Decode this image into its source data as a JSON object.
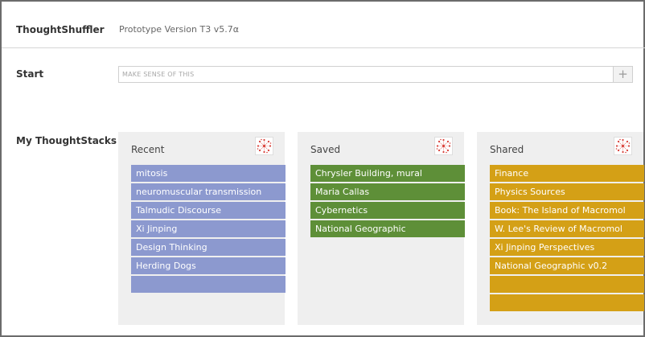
{
  "header": {
    "app_name": "ThoughtShuffler",
    "version": "Prototype Version T3 v5.7α"
  },
  "start": {
    "label": "Start",
    "placeholder": "MAKE SENSE OF THIS",
    "add_label": "+"
  },
  "stacks_section": {
    "label": "My ThoughtStacks"
  },
  "stacks": {
    "recent": {
      "title": "Recent",
      "items": [
        "mitosis",
        "neuromuscular transmission",
        "Talmudic Discourse",
        "Xi Jinping",
        "Design Thinking",
        "Herding Dogs",
        ""
      ]
    },
    "saved": {
      "title": "Saved",
      "items": [
        "Chrysler Building, mural",
        "Maria Callas",
        "Cybernetics",
        "National Geographic"
      ]
    },
    "shared": {
      "title": "Shared",
      "items": [
        "Finance",
        "Physics Sources",
        "Book: The Island of Macromol",
        "W. Lee's Review of Macromol",
        "Xi Jinping Perspectives",
        "National Geographic v0.2",
        "",
        ""
      ]
    }
  },
  "colors": {
    "recent": "#8c99cf",
    "saved": "#5e8f38",
    "shared": "#d4a016",
    "stack_icon": "#d9413a"
  },
  "icons": {
    "stack_icon": "network-burst-icon",
    "add": "plus-icon"
  }
}
